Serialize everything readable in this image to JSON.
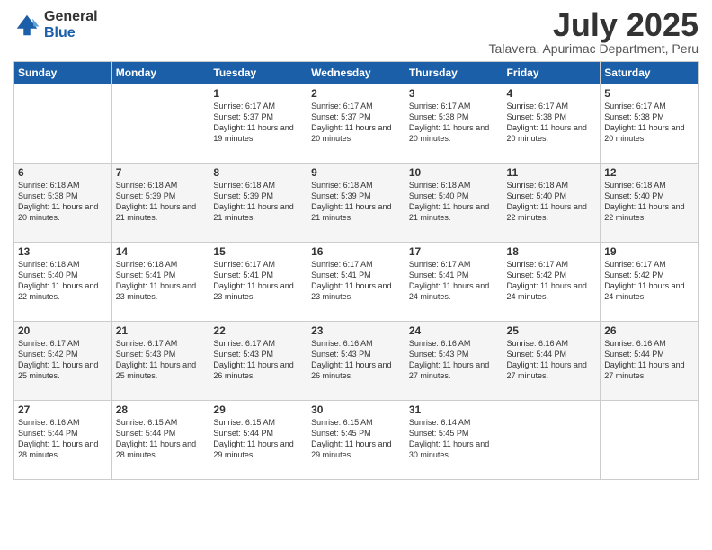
{
  "logo": {
    "general": "General",
    "blue": "Blue"
  },
  "title": "July 2025",
  "subtitle": "Talavera, Apurimac Department, Peru",
  "days_of_week": [
    "Sunday",
    "Monday",
    "Tuesday",
    "Wednesday",
    "Thursday",
    "Friday",
    "Saturday"
  ],
  "weeks": [
    [
      {
        "day": "",
        "info": ""
      },
      {
        "day": "",
        "info": ""
      },
      {
        "day": "1",
        "info": "Sunrise: 6:17 AM\nSunset: 5:37 PM\nDaylight: 11 hours and 19 minutes."
      },
      {
        "day": "2",
        "info": "Sunrise: 6:17 AM\nSunset: 5:37 PM\nDaylight: 11 hours and 20 minutes."
      },
      {
        "day": "3",
        "info": "Sunrise: 6:17 AM\nSunset: 5:38 PM\nDaylight: 11 hours and 20 minutes."
      },
      {
        "day": "4",
        "info": "Sunrise: 6:17 AM\nSunset: 5:38 PM\nDaylight: 11 hours and 20 minutes."
      },
      {
        "day": "5",
        "info": "Sunrise: 6:17 AM\nSunset: 5:38 PM\nDaylight: 11 hours and 20 minutes."
      }
    ],
    [
      {
        "day": "6",
        "info": "Sunrise: 6:18 AM\nSunset: 5:38 PM\nDaylight: 11 hours and 20 minutes."
      },
      {
        "day": "7",
        "info": "Sunrise: 6:18 AM\nSunset: 5:39 PM\nDaylight: 11 hours and 21 minutes."
      },
      {
        "day": "8",
        "info": "Sunrise: 6:18 AM\nSunset: 5:39 PM\nDaylight: 11 hours and 21 minutes."
      },
      {
        "day": "9",
        "info": "Sunrise: 6:18 AM\nSunset: 5:39 PM\nDaylight: 11 hours and 21 minutes."
      },
      {
        "day": "10",
        "info": "Sunrise: 6:18 AM\nSunset: 5:40 PM\nDaylight: 11 hours and 21 minutes."
      },
      {
        "day": "11",
        "info": "Sunrise: 6:18 AM\nSunset: 5:40 PM\nDaylight: 11 hours and 22 minutes."
      },
      {
        "day": "12",
        "info": "Sunrise: 6:18 AM\nSunset: 5:40 PM\nDaylight: 11 hours and 22 minutes."
      }
    ],
    [
      {
        "day": "13",
        "info": "Sunrise: 6:18 AM\nSunset: 5:40 PM\nDaylight: 11 hours and 22 minutes."
      },
      {
        "day": "14",
        "info": "Sunrise: 6:18 AM\nSunset: 5:41 PM\nDaylight: 11 hours and 23 minutes."
      },
      {
        "day": "15",
        "info": "Sunrise: 6:17 AM\nSunset: 5:41 PM\nDaylight: 11 hours and 23 minutes."
      },
      {
        "day": "16",
        "info": "Sunrise: 6:17 AM\nSunset: 5:41 PM\nDaylight: 11 hours and 23 minutes."
      },
      {
        "day": "17",
        "info": "Sunrise: 6:17 AM\nSunset: 5:41 PM\nDaylight: 11 hours and 24 minutes."
      },
      {
        "day": "18",
        "info": "Sunrise: 6:17 AM\nSunset: 5:42 PM\nDaylight: 11 hours and 24 minutes."
      },
      {
        "day": "19",
        "info": "Sunrise: 6:17 AM\nSunset: 5:42 PM\nDaylight: 11 hours and 24 minutes."
      }
    ],
    [
      {
        "day": "20",
        "info": "Sunrise: 6:17 AM\nSunset: 5:42 PM\nDaylight: 11 hours and 25 minutes."
      },
      {
        "day": "21",
        "info": "Sunrise: 6:17 AM\nSunset: 5:43 PM\nDaylight: 11 hours and 25 minutes."
      },
      {
        "day": "22",
        "info": "Sunrise: 6:17 AM\nSunset: 5:43 PM\nDaylight: 11 hours and 26 minutes."
      },
      {
        "day": "23",
        "info": "Sunrise: 6:16 AM\nSunset: 5:43 PM\nDaylight: 11 hours and 26 minutes."
      },
      {
        "day": "24",
        "info": "Sunrise: 6:16 AM\nSunset: 5:43 PM\nDaylight: 11 hours and 27 minutes."
      },
      {
        "day": "25",
        "info": "Sunrise: 6:16 AM\nSunset: 5:44 PM\nDaylight: 11 hours and 27 minutes."
      },
      {
        "day": "26",
        "info": "Sunrise: 6:16 AM\nSunset: 5:44 PM\nDaylight: 11 hours and 27 minutes."
      }
    ],
    [
      {
        "day": "27",
        "info": "Sunrise: 6:16 AM\nSunset: 5:44 PM\nDaylight: 11 hours and 28 minutes."
      },
      {
        "day": "28",
        "info": "Sunrise: 6:15 AM\nSunset: 5:44 PM\nDaylight: 11 hours and 28 minutes."
      },
      {
        "day": "29",
        "info": "Sunrise: 6:15 AM\nSunset: 5:44 PM\nDaylight: 11 hours and 29 minutes."
      },
      {
        "day": "30",
        "info": "Sunrise: 6:15 AM\nSunset: 5:45 PM\nDaylight: 11 hours and 29 minutes."
      },
      {
        "day": "31",
        "info": "Sunrise: 6:14 AM\nSunset: 5:45 PM\nDaylight: 11 hours and 30 minutes."
      },
      {
        "day": "",
        "info": ""
      },
      {
        "day": "",
        "info": ""
      }
    ]
  ]
}
